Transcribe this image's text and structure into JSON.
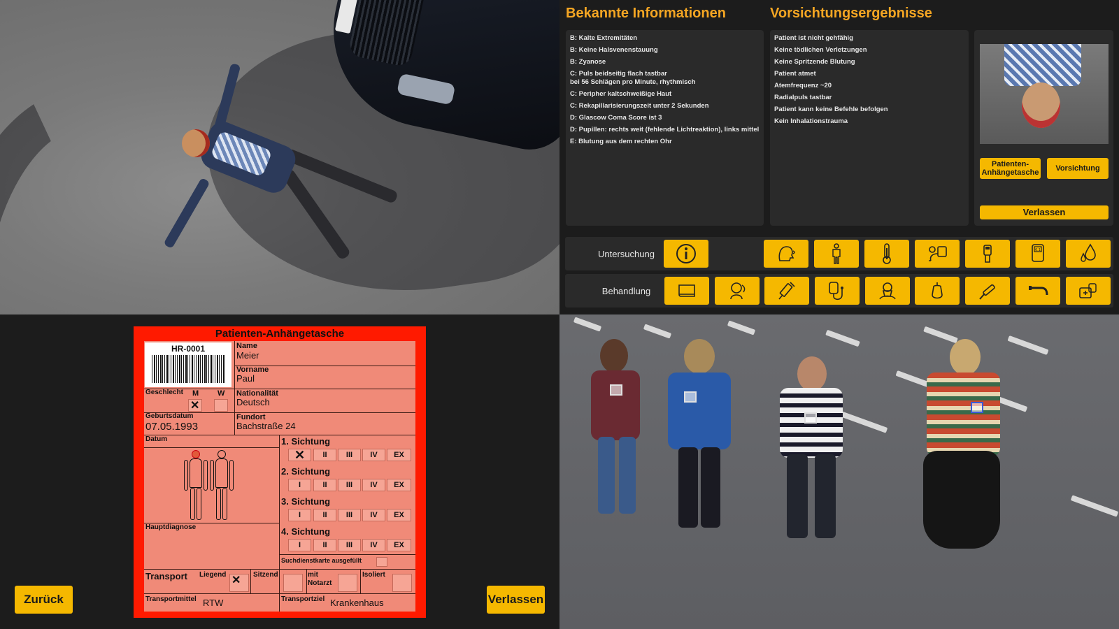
{
  "known_info": {
    "title": "Bekannte Informationen",
    "items": [
      "B: Kalte Extremitäten",
      "B: Keine Halsvenenstauung",
      "B: Zyanose",
      "C: Puls beidseitig flach tastbar\nbei 56 Schlägen pro Minute, rhythmisch",
      "C: Peripher kaltschweißige Haut",
      "C: Rekapillarisierungszeit unter 2 Sekunden",
      "D: Glascow Coma Score ist 3",
      "D: Pupillen: rechts weit (fehlende Lichtreaktion), links mittel",
      "E: Blutung aus dem rechten Ohr"
    ]
  },
  "precaution_results": {
    "title": "Vorsichtungsergebnisse",
    "items": [
      "Patient ist nicht gehfähig",
      "Keine tödlichen Verletzungen",
      "Keine Spritzende Blutung",
      "Patient atmet",
      "Atemfrequenz ~20",
      "Radialpuls tastbar",
      "Patient kann keine Befehle befolgen",
      "Kein Inhalationstrauma"
    ]
  },
  "side_buttons": {
    "tag_label": "Patienten-\nAnhängetasche",
    "precaution_label": "Vorsichtung",
    "leave_label": "Verlassen"
  },
  "rows": {
    "exam_label": "Untersuchung",
    "treatment_label": "Behandlung",
    "exam_icons": [
      "info-icon",
      "breathing-check-icon",
      "body-check-icon",
      "thermometer-icon",
      "blood-pressure-icon",
      "pulse-oximeter-icon",
      "glucose-meter-icon",
      "blood-drop-icon"
    ],
    "treatment_icons": [
      "blanket-icon",
      "head-position-icon",
      "syringe-icon",
      "infusion-icon",
      "oxygen-mask-icon",
      "infusion-bag-icon",
      "tourniquet-icon",
      "airway-tube-icon",
      "medical-kit-icon"
    ]
  },
  "tag": {
    "title": "Patienten-Anhängetasche",
    "id": "HR-0001",
    "name_label": "Name",
    "name": "Meier",
    "firstname_label": "Vorname",
    "firstname": "Paul",
    "gender_label": "Geschlecht",
    "gender_m": "M",
    "gender_w": "W",
    "gender_selected": "M",
    "nationality_label": "Nationalität",
    "nationality": "Deutsch",
    "birthdate_label": "Geburtsdatum",
    "birthdate": "07.05.1993",
    "fundort_label": "Fundort",
    "fundort": "Bachstraße 24",
    "date_label": "Datum",
    "diagnosis_label": "Hauptdiagnose",
    "sightings": [
      {
        "label": "1. Sichtung",
        "selected": "I"
      },
      {
        "label": "2. Sichtung",
        "selected": ""
      },
      {
        "label": "3. Sichtung",
        "selected": ""
      },
      {
        "label": "4. Sichtung",
        "selected": ""
      }
    ],
    "categories": [
      "I",
      "II",
      "III",
      "IV",
      "EX"
    ],
    "search_card_label": "Suchdienstkarte ausgefüllt",
    "transport_label": "Transport",
    "lying_label": "Liegend",
    "sitting_label": "Sitzend",
    "with_doctor_label": "mit\nNotarzt",
    "isolated_label": "Isoliert",
    "transport_selected": "Liegend",
    "transport_means_label": "Transportmittel",
    "transport_means": "RTW",
    "destination_label": "Transportziel",
    "destination": "Krankenhaus"
  },
  "nav": {
    "back_label": "Zurück",
    "leave_label": "Verlassen"
  },
  "colors": {
    "accent": "#f5b800",
    "heading": "#f5a623",
    "tag_border": "#ff1a00",
    "tag_fill": "#f08a78"
  }
}
